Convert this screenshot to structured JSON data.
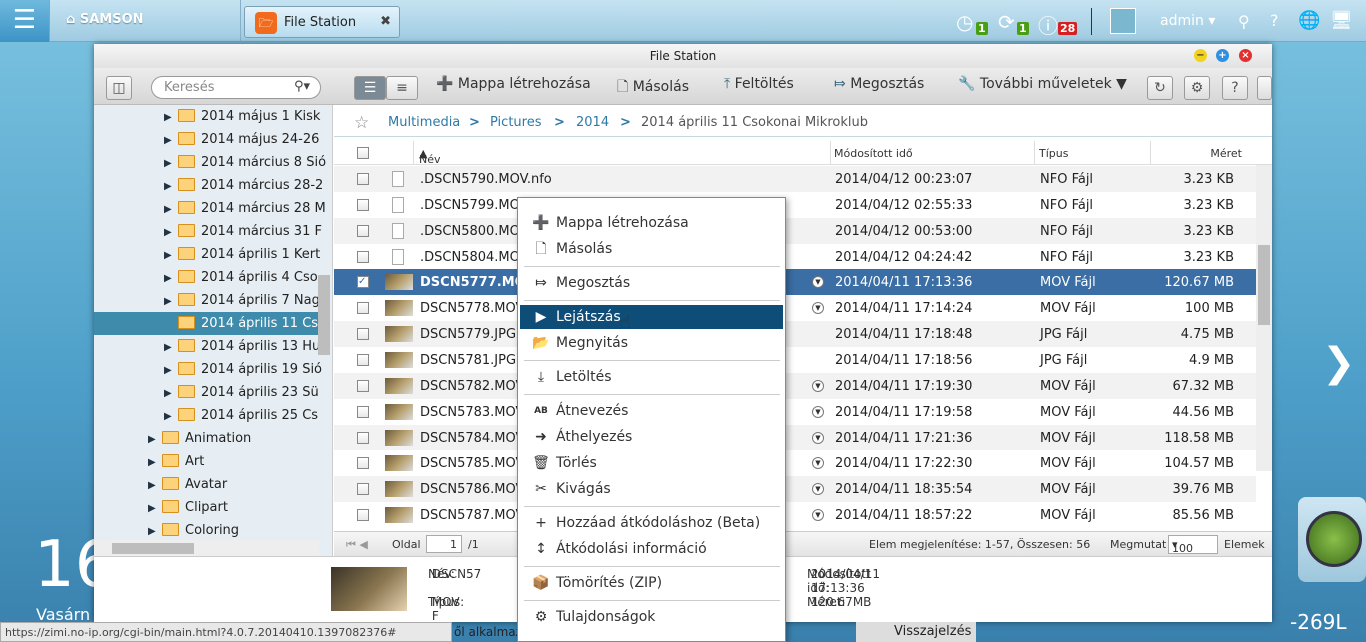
{
  "topbar": {
    "device": "SAMSON",
    "app_tab": "File Station",
    "badges": {
      "tasks": "1",
      "devices": "1",
      "notifications": "28"
    },
    "user": "admin"
  },
  "window": {
    "title": "File Station"
  },
  "toolbar": {
    "search_placeholder": "Keresés",
    "create_folder": "Mappa létrehozása",
    "copy": "Másolás",
    "upload": "Feltöltés",
    "share": "Megosztás",
    "more": "További műveletek"
  },
  "tree": [
    {
      "label": "2014 május 1 Kisk",
      "level": 2
    },
    {
      "label": "2014 május 24-26",
      "level": 2
    },
    {
      "label": "2014 március 8 Sió",
      "level": 2
    },
    {
      "label": "2014 március 28-2",
      "level": 2
    },
    {
      "label": "2014 március 28 M",
      "level": 2
    },
    {
      "label": "2014 március 31 F",
      "level": 2
    },
    {
      "label": "2014 április 1 Kert",
      "level": 2
    },
    {
      "label": "2014 április 4 Cso",
      "level": 2
    },
    {
      "label": "2014 április 7 Nag",
      "level": 2
    },
    {
      "label": "2014 április 11 Cs",
      "level": 2,
      "selected": true
    },
    {
      "label": "2014 április 13 Hu",
      "level": 2
    },
    {
      "label": "2014 április 19 Sió",
      "level": 2
    },
    {
      "label": "2014 április 23 Sü",
      "level": 2
    },
    {
      "label": "2014 április 25 Cs",
      "level": 2
    },
    {
      "label": "Animation",
      "level": 1
    },
    {
      "label": "Art",
      "level": 1
    },
    {
      "label": "Avatar",
      "level": 1
    },
    {
      "label": "Clipart",
      "level": 1
    },
    {
      "label": "Coloring",
      "level": 1
    }
  ],
  "breadcrumb": [
    "Multimedia",
    "Pictures",
    "2014",
    "2014 április 11 Csokonai Mikroklub"
  ],
  "columns": {
    "name": "Név",
    "modified": "Módosított idő",
    "type": "Típus",
    "size": "Méret"
  },
  "files": [
    {
      "name": ".DSCN5790.MOV.nfo",
      "modified": "2014/04/12 00:23:07",
      "type": "NFO Fájl",
      "size": "3.23 KB",
      "kind": "doc"
    },
    {
      "name": ".DSCN5799.MOV",
      "modified": "2014/04/12 02:55:33",
      "type": "NFO Fájl",
      "size": "3.23 KB",
      "kind": "doc"
    },
    {
      "name": ".DSCN5800.MOV",
      "modified": "2014/04/12 00:53:00",
      "type": "NFO Fájl",
      "size": "3.23 KB",
      "kind": "doc"
    },
    {
      "name": ".DSCN5804.MOV",
      "modified": "2014/04/12 04:24:42",
      "type": "NFO Fájl",
      "size": "3.23 KB",
      "kind": "doc"
    },
    {
      "name": "DSCN5777.MOV",
      "modified": "2014/04/11 17:13:36",
      "type": "MOV Fájl",
      "size": "120.67 MB",
      "kind": "video",
      "selected": true
    },
    {
      "name": "DSCN5778.MOV",
      "modified": "2014/04/11 17:14:24",
      "type": "MOV Fájl",
      "size": "100 MB",
      "kind": "video"
    },
    {
      "name": "DSCN5779.JPG",
      "modified": "2014/04/11 17:18:48",
      "type": "JPG Fájl",
      "size": "4.75 MB",
      "kind": "image"
    },
    {
      "name": "DSCN5781.JPG",
      "modified": "2014/04/11 17:18:56",
      "type": "JPG Fájl",
      "size": "4.9 MB",
      "kind": "image"
    },
    {
      "name": "DSCN5782.MOV",
      "modified": "2014/04/11 17:19:30",
      "type": "MOV Fájl",
      "size": "67.32 MB",
      "kind": "video"
    },
    {
      "name": "DSCN5783.MOV",
      "modified": "2014/04/11 17:19:58",
      "type": "MOV Fájl",
      "size": "44.56 MB",
      "kind": "video"
    },
    {
      "name": "DSCN5784.MOV",
      "modified": "2014/04/11 17:21:36",
      "type": "MOV Fájl",
      "size": "118.58 MB",
      "kind": "video"
    },
    {
      "name": "DSCN5785.MOV",
      "modified": "2014/04/11 17:22:30",
      "type": "MOV Fájl",
      "size": "104.57 MB",
      "kind": "video"
    },
    {
      "name": "DSCN5786.MOV",
      "modified": "2014/04/11 18:35:54",
      "type": "MOV Fájl",
      "size": "39.76 MB",
      "kind": "video"
    },
    {
      "name": "DSCN5787.MOV",
      "modified": "2014/04/11 18:57:22",
      "type": "MOV Fájl",
      "size": "85.56 MB",
      "kind": "video"
    }
  ],
  "pager": {
    "page_label": "Oldal",
    "page": "1",
    "total": "/1",
    "summary": "Elem megjelenítése: 1-57, Összesen: 56",
    "show_label": "Megmutat",
    "per_page": "100",
    "items_label": "Elemek"
  },
  "details": {
    "name_label": "Név:",
    "name": "DSCN57",
    "type_label": "Típus:",
    "type": "MOV F",
    "modified_label": "Módosított idő:",
    "modified": "2014/04/11 17:13:36",
    "size_label": "Méret:",
    "size": "120.67MB"
  },
  "context_menu": [
    {
      "label": "Mappa létrehozása",
      "icon": "plus-circle"
    },
    {
      "label": "Másolás",
      "icon": "copy"
    },
    {
      "sep": true
    },
    {
      "label": "Megosztás",
      "icon": "share"
    },
    {
      "sep": true
    },
    {
      "label": "Lejátszás",
      "icon": "play",
      "highlighted": true
    },
    {
      "label": "Megnyitás",
      "icon": "folder-open"
    },
    {
      "sep": true
    },
    {
      "label": "Letöltés",
      "icon": "download"
    },
    {
      "sep": true
    },
    {
      "label": "Átnevezés",
      "icon": "rename"
    },
    {
      "label": "Áthelyezés",
      "icon": "move"
    },
    {
      "label": "Törlés",
      "icon": "trash"
    },
    {
      "label": "Kivágás",
      "icon": "scissors"
    },
    {
      "sep": true
    },
    {
      "label": "Hozzáad átkódoláshoz (Beta)",
      "icon": "plus"
    },
    {
      "label": "Átkódolási információ",
      "icon": "transcode-info"
    },
    {
      "sep": true
    },
    {
      "label": "Tömörítés (ZIP)",
      "icon": "zip"
    },
    {
      "sep": true
    },
    {
      "label": "Tulajdonságok",
      "icon": "gears"
    }
  ],
  "desktop": {
    "clock_fragment": "16",
    "day_fragment": "Vasárn",
    "apps_fragment": "ől alkalmaz",
    "feedback": "Visszajelzés",
    "model_fragment": "-269L"
  },
  "status_url": "https://zimi.no-ip.org/cgi-bin/main.html?4.0.7.20140410.1397082376#",
  "colors": {
    "selection": "#3a6ea5",
    "tree_selection": "#3f8bab",
    "menu_highlight": "#0f4d79",
    "badge_green": "#4a9e14",
    "badge_red": "#d42020"
  }
}
